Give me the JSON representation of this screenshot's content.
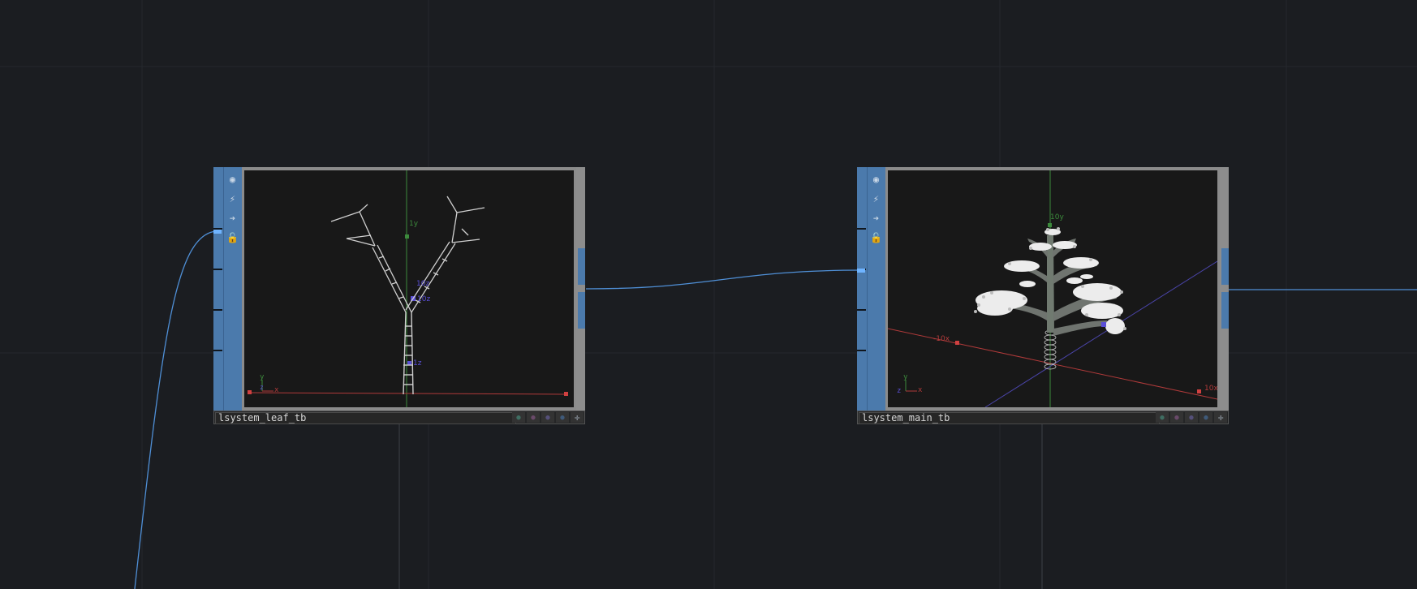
{
  "nodes": {
    "leaf": {
      "name": "lsystem_leaf_tb",
      "labels": {
        "y_axis": "1y",
        "z_top": "10z",
        "z_mid": "10z",
        "z_low": "1z"
      },
      "axis_gizmo": {
        "y": "y",
        "z": "z",
        "x": "x"
      }
    },
    "main": {
      "name": "lsystem_main_tb",
      "labels": {
        "y_axis": "10y",
        "x_neg": "-10x",
        "x_pos": "10x"
      },
      "axis_gizmo": {
        "y": "y",
        "z": "z",
        "x": "x"
      }
    }
  },
  "toolbar_icons": [
    "viewer-toggle-icon",
    "cook-flag-icon",
    "pass-through-icon",
    "lock-icon"
  ],
  "flag_icons": [
    "bypass-flag-icon",
    "display-flag-icon",
    "render-flag-icon",
    "clone-flag-icon",
    "expand-icon"
  ],
  "colors": {
    "background": "#1b1d21",
    "wire": "#4f8fd6",
    "node_accent": "#4b7aac",
    "y_axis": "#3c8a3c",
    "x_axis": "#b03a3a",
    "z_axis": "#5a4fd6"
  }
}
